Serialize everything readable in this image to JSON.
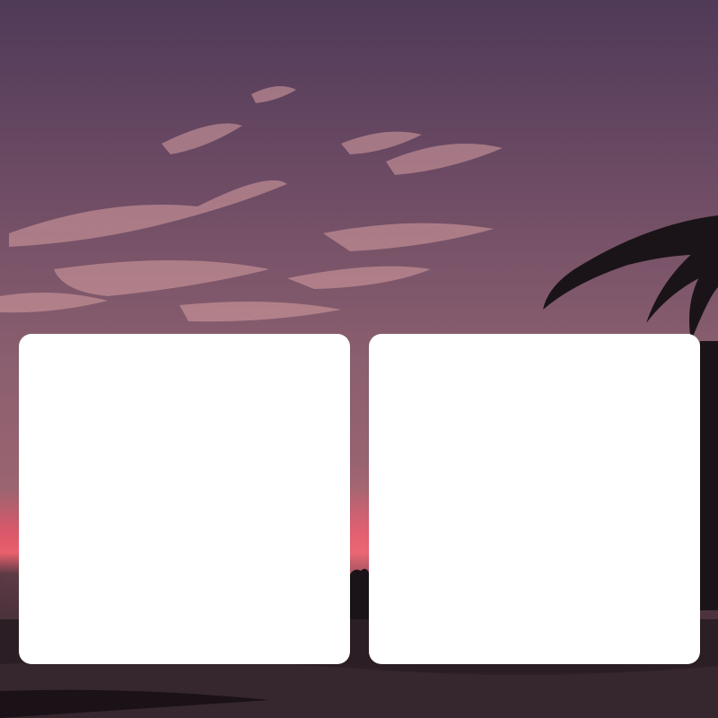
{
  "wallpaper": {
    "description_icon": "sunset-beach-palm-wallpaper",
    "colors": {
      "sky_top": "#5b3e59",
      "sky_mid": "#8a5f6f",
      "horizon_glow": "#e05a6a",
      "ground": "#2a1f24",
      "cloud": "#d9a0a0",
      "palm": "#1a1418"
    }
  },
  "cards": [
    {
      "id": "left",
      "color": "#ffffff"
    },
    {
      "id": "right",
      "color": "#ffffff"
    }
  ]
}
